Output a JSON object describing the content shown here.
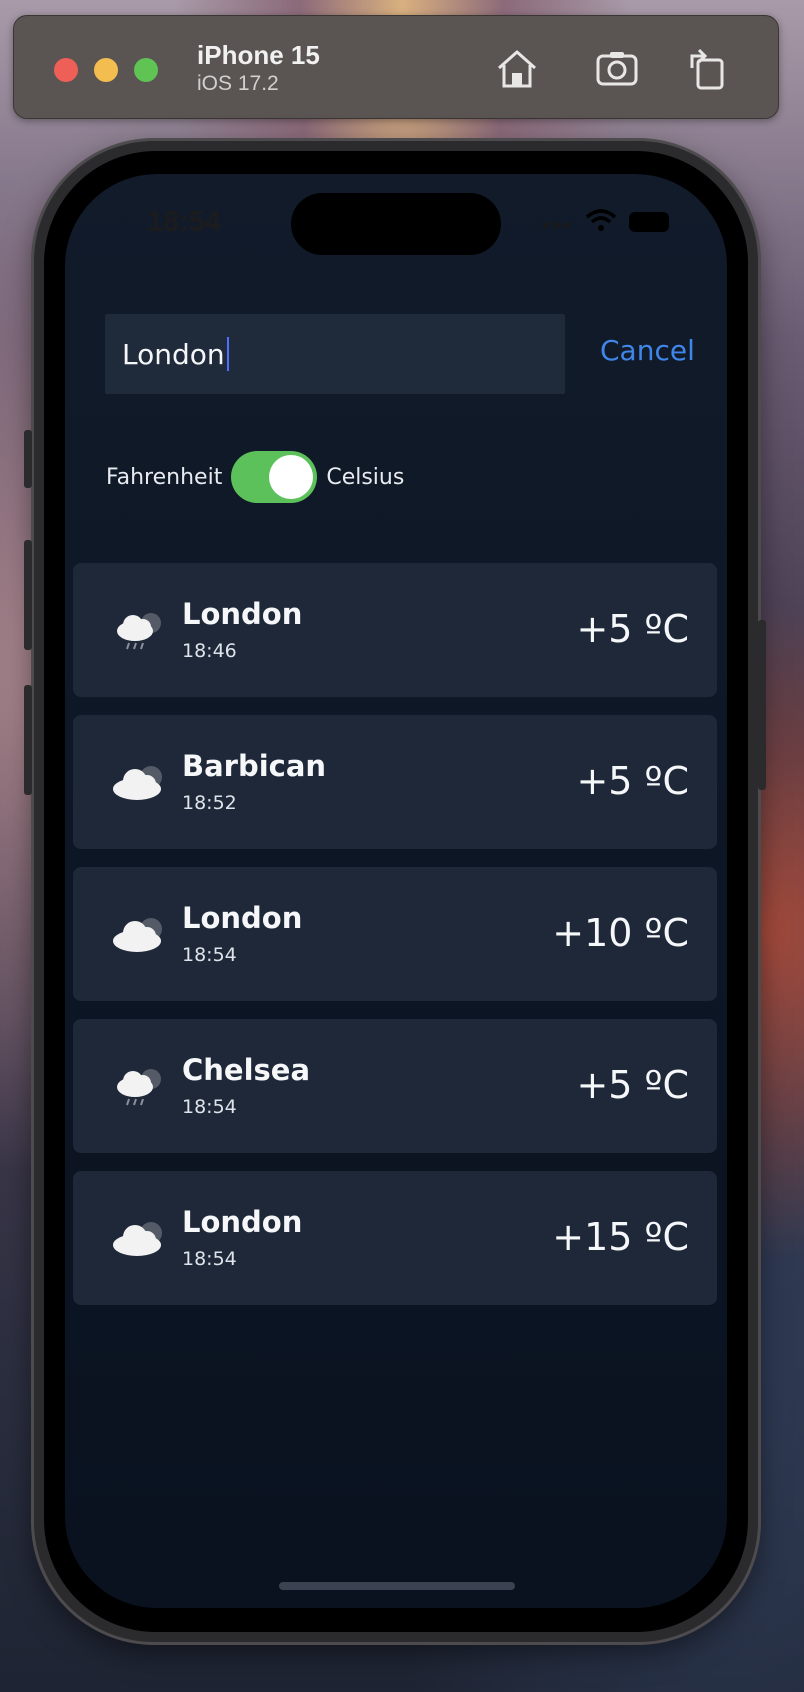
{
  "simulator": {
    "device_name": "iPhone 15",
    "os_version": "iOS 17.2",
    "icons": [
      "home-icon",
      "screenshot-icon",
      "rotate-icon"
    ]
  },
  "status_bar": {
    "time": "18:54"
  },
  "search": {
    "value": "London",
    "cancel_label": "Cancel"
  },
  "units": {
    "left_label": "Fahrenheit",
    "right_label": "Celsius",
    "celsius_selected": true
  },
  "results": [
    {
      "city": "London",
      "time": "18:46",
      "temp": "+5 ºC",
      "icon": "cloud-rain-icon"
    },
    {
      "city": "Barbican",
      "time": "18:52",
      "temp": "+5 ºC",
      "icon": "cloudy-icon"
    },
    {
      "city": "London",
      "time": "18:54",
      "temp": "+10 ºC",
      "icon": "cloudy-icon"
    },
    {
      "city": "Chelsea",
      "time": "18:54",
      "temp": "+5 ºC",
      "icon": "cloud-rain-icon"
    },
    {
      "city": "London",
      "time": "18:54",
      "temp": "+15 ºC",
      "icon": "cloudy-icon"
    }
  ],
  "colors": {
    "accent": "#3f86e8",
    "toggle_on": "#5cc15a",
    "card_bg": "#1e2839",
    "screen_bg": "#0d1624"
  }
}
